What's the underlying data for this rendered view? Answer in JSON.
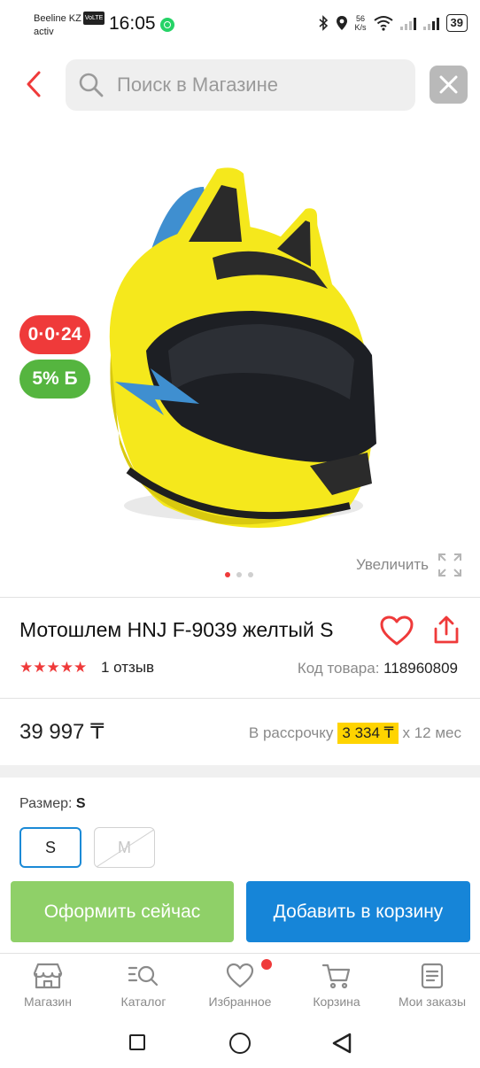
{
  "status_bar": {
    "carrier": "Beeline KZ",
    "volte": "VoLTE",
    "carrier2": "activ",
    "time": "16:05",
    "speed_value": "56",
    "speed_unit": "K/s",
    "battery": "39"
  },
  "header": {
    "search_placeholder": "Поиск в Магазине"
  },
  "gallery": {
    "timer_badge": "0·0·24",
    "bonus_badge": "5% Б",
    "zoom_label": "Увеличить",
    "slide_count": 3,
    "active_slide": 1
  },
  "product": {
    "title": "Мотошлем HNJ F-9039 желтый S",
    "rating_stars": 5,
    "stars": "★★★★★",
    "reviews": "1 отзыв",
    "code_label": "Код товара:",
    "code": "118960809",
    "price": "39 997 ₸",
    "installment_prefix": "В рассрочку",
    "installment_amount": "3 334 ₸",
    "installment_suffix": "х 12 мес",
    "size_label": "Размер:",
    "size_selected": "S",
    "sizes": [
      "S",
      "M"
    ]
  },
  "actions": {
    "buy_now": "Оформить сейчас",
    "add_to_cart": "Добавить в корзину"
  },
  "tabbar": {
    "items": [
      {
        "label": "Магазин",
        "icon": "store-icon"
      },
      {
        "label": "Каталог",
        "icon": "catalog-search-icon"
      },
      {
        "label": "Избранное",
        "icon": "heart-icon"
      },
      {
        "label": "Корзина",
        "icon": "cart-icon"
      },
      {
        "label": "Мои заказы",
        "icon": "orders-icon"
      }
    ]
  },
  "colors": {
    "accent_red": "#ef3a3a",
    "primary_blue": "#1685d8",
    "buy_green": "#8fd068",
    "bonus_green": "#55b53f",
    "installment_yellow": "#ffd400"
  }
}
